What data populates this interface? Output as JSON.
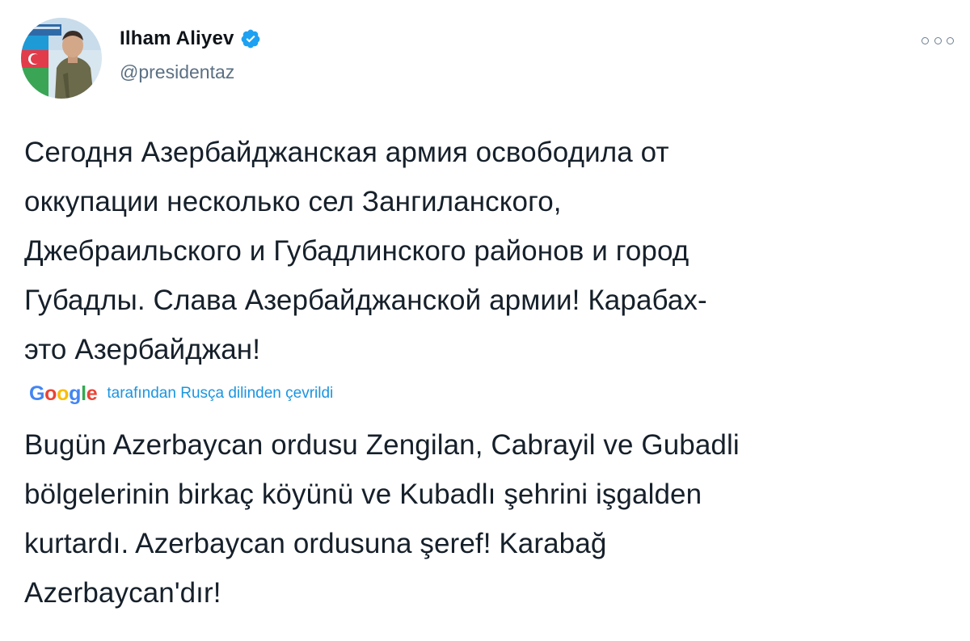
{
  "author": {
    "display_name": "Ilham Aliyev",
    "handle": "@presidentaz",
    "verified": true,
    "avatar_icon": "profile-photo-avatar"
  },
  "menu": {
    "icon": "more-horizontal-icon"
  },
  "tweet": {
    "original_lines": [
      "Сегодня Азербайджанская армия освободила от",
      "оккупации несколько сел Зангиланского,",
      "Джебраильского и Губадлинского районов и город",
      "Губадлы. Слава Азербайджанской армии! Карабах-",
      "это Азербайджан!"
    ],
    "translation_provider": "Google",
    "translation_label": "tarafından Rusça dilinden çevrildi",
    "translated_lines": [
      "Bugün Azerbaycan ordusu Zengilan, Cabrayil ve Gubadli",
      "bölgelerinin birkaç köyünü ve Kubadlı şehrini işgalden",
      "kurtardı. Azerbaycan ordusuna şeref! Karabağ",
      "Azerbaycan'dır!"
    ]
  },
  "colors": {
    "text": "#16202a",
    "secondary": "#5b7083",
    "link": "#1b95e0",
    "verified": "#1da1f2",
    "google_blue": "#4285f4",
    "google_red": "#ea4335",
    "google_yellow": "#fbbc05",
    "google_green": "#34a853"
  }
}
